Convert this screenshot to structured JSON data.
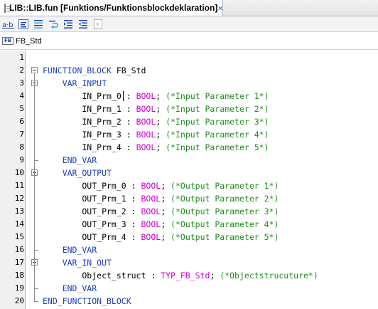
{
  "tab": {
    "title": "LIB::LIB.fun [Funktions/Funktionsblockdeklaration]",
    "close_glyph": "×",
    "icon": "document-icon"
  },
  "toolbar": {
    "buttons": [
      {
        "name": "abc-format-icon",
        "text": "a·b"
      },
      {
        "name": "format-block-icon",
        "text": ""
      },
      {
        "name": "align-icon",
        "text": ""
      },
      {
        "name": "wrap-icon",
        "text": ""
      },
      {
        "name": "indent-icon",
        "text": ""
      },
      {
        "name": "outdent-icon",
        "text": ""
      },
      {
        "name": "disabled-action-icon",
        "text": ""
      }
    ]
  },
  "object": {
    "icon_label": "FB",
    "name": "FB_Std"
  },
  "colors": {
    "keyword": "#1a3dbf",
    "type": "#d100d1",
    "comment": "#1f8c1f"
  },
  "editor": {
    "lines": [
      {
        "n": "1",
        "parts": []
      },
      {
        "n": "2",
        "parts": [
          {
            "t": "FUNCTION_BLOCK",
            "c": "kw"
          },
          {
            "t": " FB_Std",
            "c": ""
          }
        ]
      },
      {
        "n": "3",
        "parts": [
          {
            "t": "    VAR_INPUT",
            "c": "kw"
          }
        ]
      },
      {
        "n": "4",
        "parts": [
          {
            "t": "        IN_Prm_0 : ",
            "c": ""
          },
          {
            "t": "BOOL",
            "c": "ty"
          },
          {
            "t": "; ",
            "c": ""
          },
          {
            "t": "(*Input Parameter 1*)",
            "c": "cm"
          }
        ]
      },
      {
        "n": "5",
        "parts": [
          {
            "t": "        IN_Prm_1 : ",
            "c": ""
          },
          {
            "t": "BOOL",
            "c": "ty"
          },
          {
            "t": "; ",
            "c": ""
          },
          {
            "t": "(*Input Parameter 2*)",
            "c": "cm"
          }
        ]
      },
      {
        "n": "6",
        "parts": [
          {
            "t": "        IN_Prm_2 : ",
            "c": ""
          },
          {
            "t": "BOOL",
            "c": "ty"
          },
          {
            "t": "; ",
            "c": ""
          },
          {
            "t": "(*Input Parameter 3*)",
            "c": "cm"
          }
        ]
      },
      {
        "n": "7",
        "parts": [
          {
            "t": "        IN_Prm_3 : ",
            "c": ""
          },
          {
            "t": "BOOL",
            "c": "ty"
          },
          {
            "t": "; ",
            "c": ""
          },
          {
            "t": "(*Input Parameter 4*)",
            "c": "cm"
          }
        ]
      },
      {
        "n": "8",
        "parts": [
          {
            "t": "        IN_Prm_4 : ",
            "c": ""
          },
          {
            "t": "BOOL",
            "c": "ty"
          },
          {
            "t": "; ",
            "c": ""
          },
          {
            "t": "(*Input Parameter 5*)",
            "c": "cm"
          }
        ]
      },
      {
        "n": "9",
        "parts": [
          {
            "t": "    END_VAR",
            "c": "kw"
          }
        ]
      },
      {
        "n": "10",
        "parts": [
          {
            "t": "    VAR_OUTPUT",
            "c": "kw"
          }
        ]
      },
      {
        "n": "11",
        "parts": [
          {
            "t": "        OUT_Prm_0 : ",
            "c": ""
          },
          {
            "t": "BOOL",
            "c": "ty"
          },
          {
            "t": "; ",
            "c": ""
          },
          {
            "t": "(*Output Parameter 1*)",
            "c": "cm"
          }
        ]
      },
      {
        "n": "12",
        "parts": [
          {
            "t": "        OUT_Prm_1 : ",
            "c": ""
          },
          {
            "t": "BOOL",
            "c": "ty"
          },
          {
            "t": "; ",
            "c": ""
          },
          {
            "t": "(*Output Parameter 2*)",
            "c": "cm"
          }
        ]
      },
      {
        "n": "13",
        "parts": [
          {
            "t": "        OUT_Prm_2 : ",
            "c": ""
          },
          {
            "t": "BOOL",
            "c": "ty"
          },
          {
            "t": "; ",
            "c": ""
          },
          {
            "t": "(*Output Parameter 3*)",
            "c": "cm"
          }
        ]
      },
      {
        "n": "14",
        "parts": [
          {
            "t": "        OUT_Prm_3 : ",
            "c": ""
          },
          {
            "t": "BOOL",
            "c": "ty"
          },
          {
            "t": "; ",
            "c": ""
          },
          {
            "t": "(*Output Parameter 4*)",
            "c": "cm"
          }
        ]
      },
      {
        "n": "15",
        "parts": [
          {
            "t": "        OUT_Prm_4 : ",
            "c": ""
          },
          {
            "t": "BOOL",
            "c": "ty"
          },
          {
            "t": "; ",
            "c": ""
          },
          {
            "t": "(*Output Parameter 5*)",
            "c": "cm"
          }
        ]
      },
      {
        "n": "16",
        "parts": [
          {
            "t": "    END_VAR",
            "c": "kw"
          }
        ]
      },
      {
        "n": "17",
        "parts": [
          {
            "t": "    VAR_IN_OUT",
            "c": "kw"
          }
        ]
      },
      {
        "n": "18",
        "parts": [
          {
            "t": "        Object_struct : ",
            "c": ""
          },
          {
            "t": "TYP_FB_Std",
            "c": "ty"
          },
          {
            "t": "; ",
            "c": ""
          },
          {
            "t": "(*Objectstrucuture*)",
            "c": "cm"
          }
        ]
      },
      {
        "n": "19",
        "parts": [
          {
            "t": "    END_VAR",
            "c": "kw"
          }
        ]
      },
      {
        "n": "20",
        "parts": [
          {
            "t": "END_FUNCTION_BLOCK",
            "c": "kw"
          }
        ]
      }
    ]
  }
}
